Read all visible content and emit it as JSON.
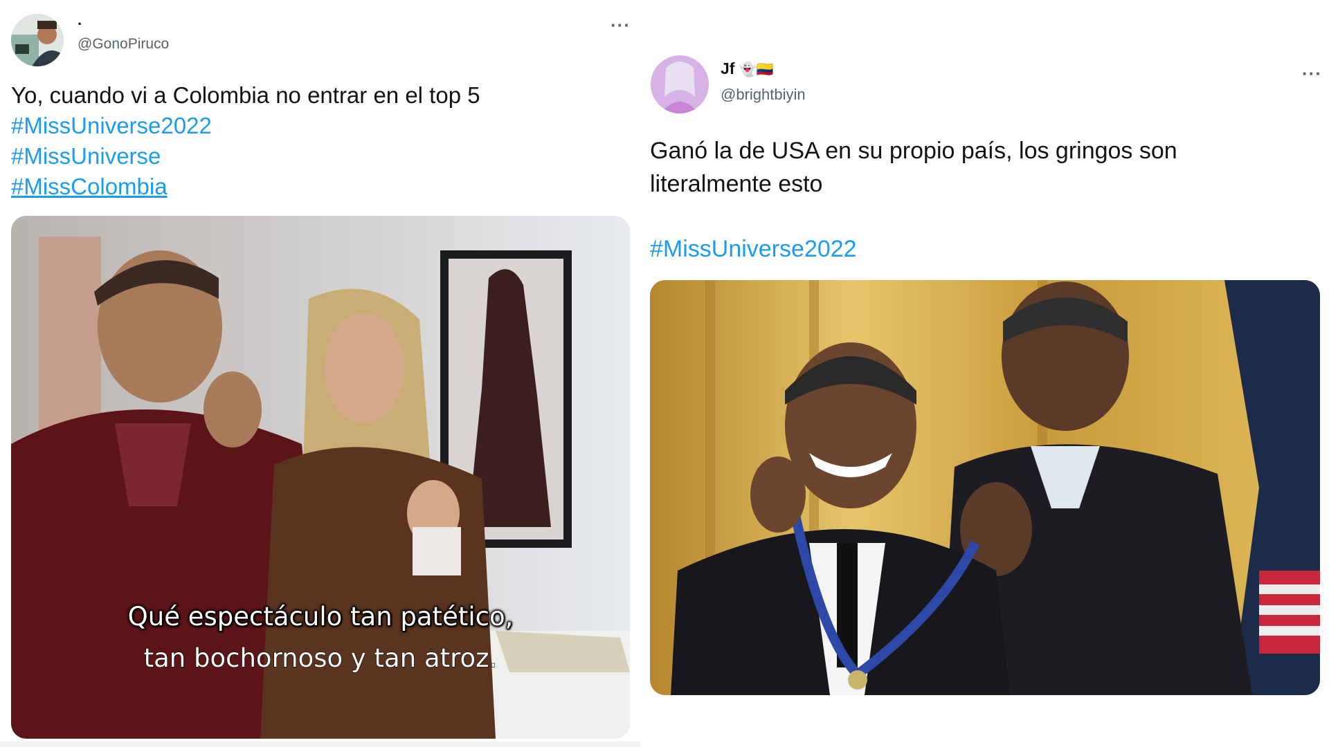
{
  "tweets": [
    {
      "display_name": ".",
      "handle": "@GonoPiruco",
      "more_label": "···",
      "text": "Yo, cuando vi a Colombia no entrar en el top 5",
      "hashtags": [
        "#MissUniverse2022",
        "#MissUniverse",
        "#MissColombia"
      ],
      "media": {
        "caption_line1": "Qué espectáculo tan patético,",
        "caption_line2": "tan bochornoso y tan atroz."
      }
    },
    {
      "display_name": "Jf",
      "display_name_emoji": "👻🇨🇴",
      "handle": "@brightbiyin",
      "more_label": "···",
      "text_line1": "Ganó la de USA en su propio país, los gringos son",
      "text_line2": "literalmente esto",
      "hashtags": [
        "#MissUniverse2022"
      ]
    }
  ],
  "colors": {
    "link": "#1d9bf0",
    "text": "#0f1419",
    "secondary": "#536471",
    "divider": "#eff3f4"
  },
  "icons": {
    "more": "more-horizontal-icon",
    "avatar_left": "avatar",
    "avatar_right": "avatar"
  }
}
